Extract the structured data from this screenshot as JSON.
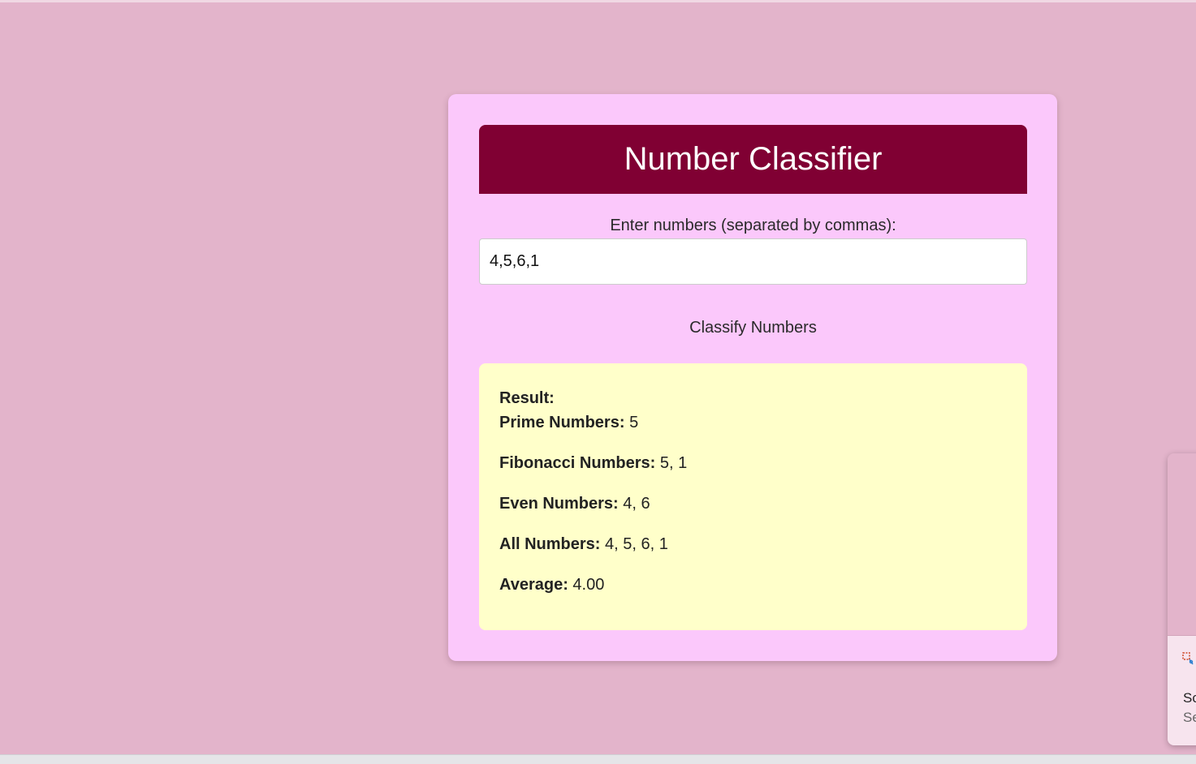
{
  "app": {
    "title": "Number Classifier"
  },
  "form": {
    "label": "Enter numbers (separated by commas):",
    "input_value": "4,5,6,1",
    "button_label": "Classify Numbers"
  },
  "result": {
    "title": "Result:",
    "items": [
      {
        "label": "Prime Numbers:",
        "value": "5"
      },
      {
        "label": "Fibonacci Numbers:",
        "value": "5, 1"
      },
      {
        "label": "Even Numbers:",
        "value": "4, 6"
      },
      {
        "label": "All Numbers:",
        "value": "4, 5, 6, 1"
      },
      {
        "label": "Average:",
        "value": "4.00"
      }
    ]
  },
  "popup": {
    "title": "Sc",
    "subtitle": "Se",
    "icon": "snipping-tool-icon"
  },
  "colors": {
    "background": "#e3b4cb",
    "card": "#fbc8fb",
    "header": "#800033",
    "result_box": "#ffffca"
  }
}
